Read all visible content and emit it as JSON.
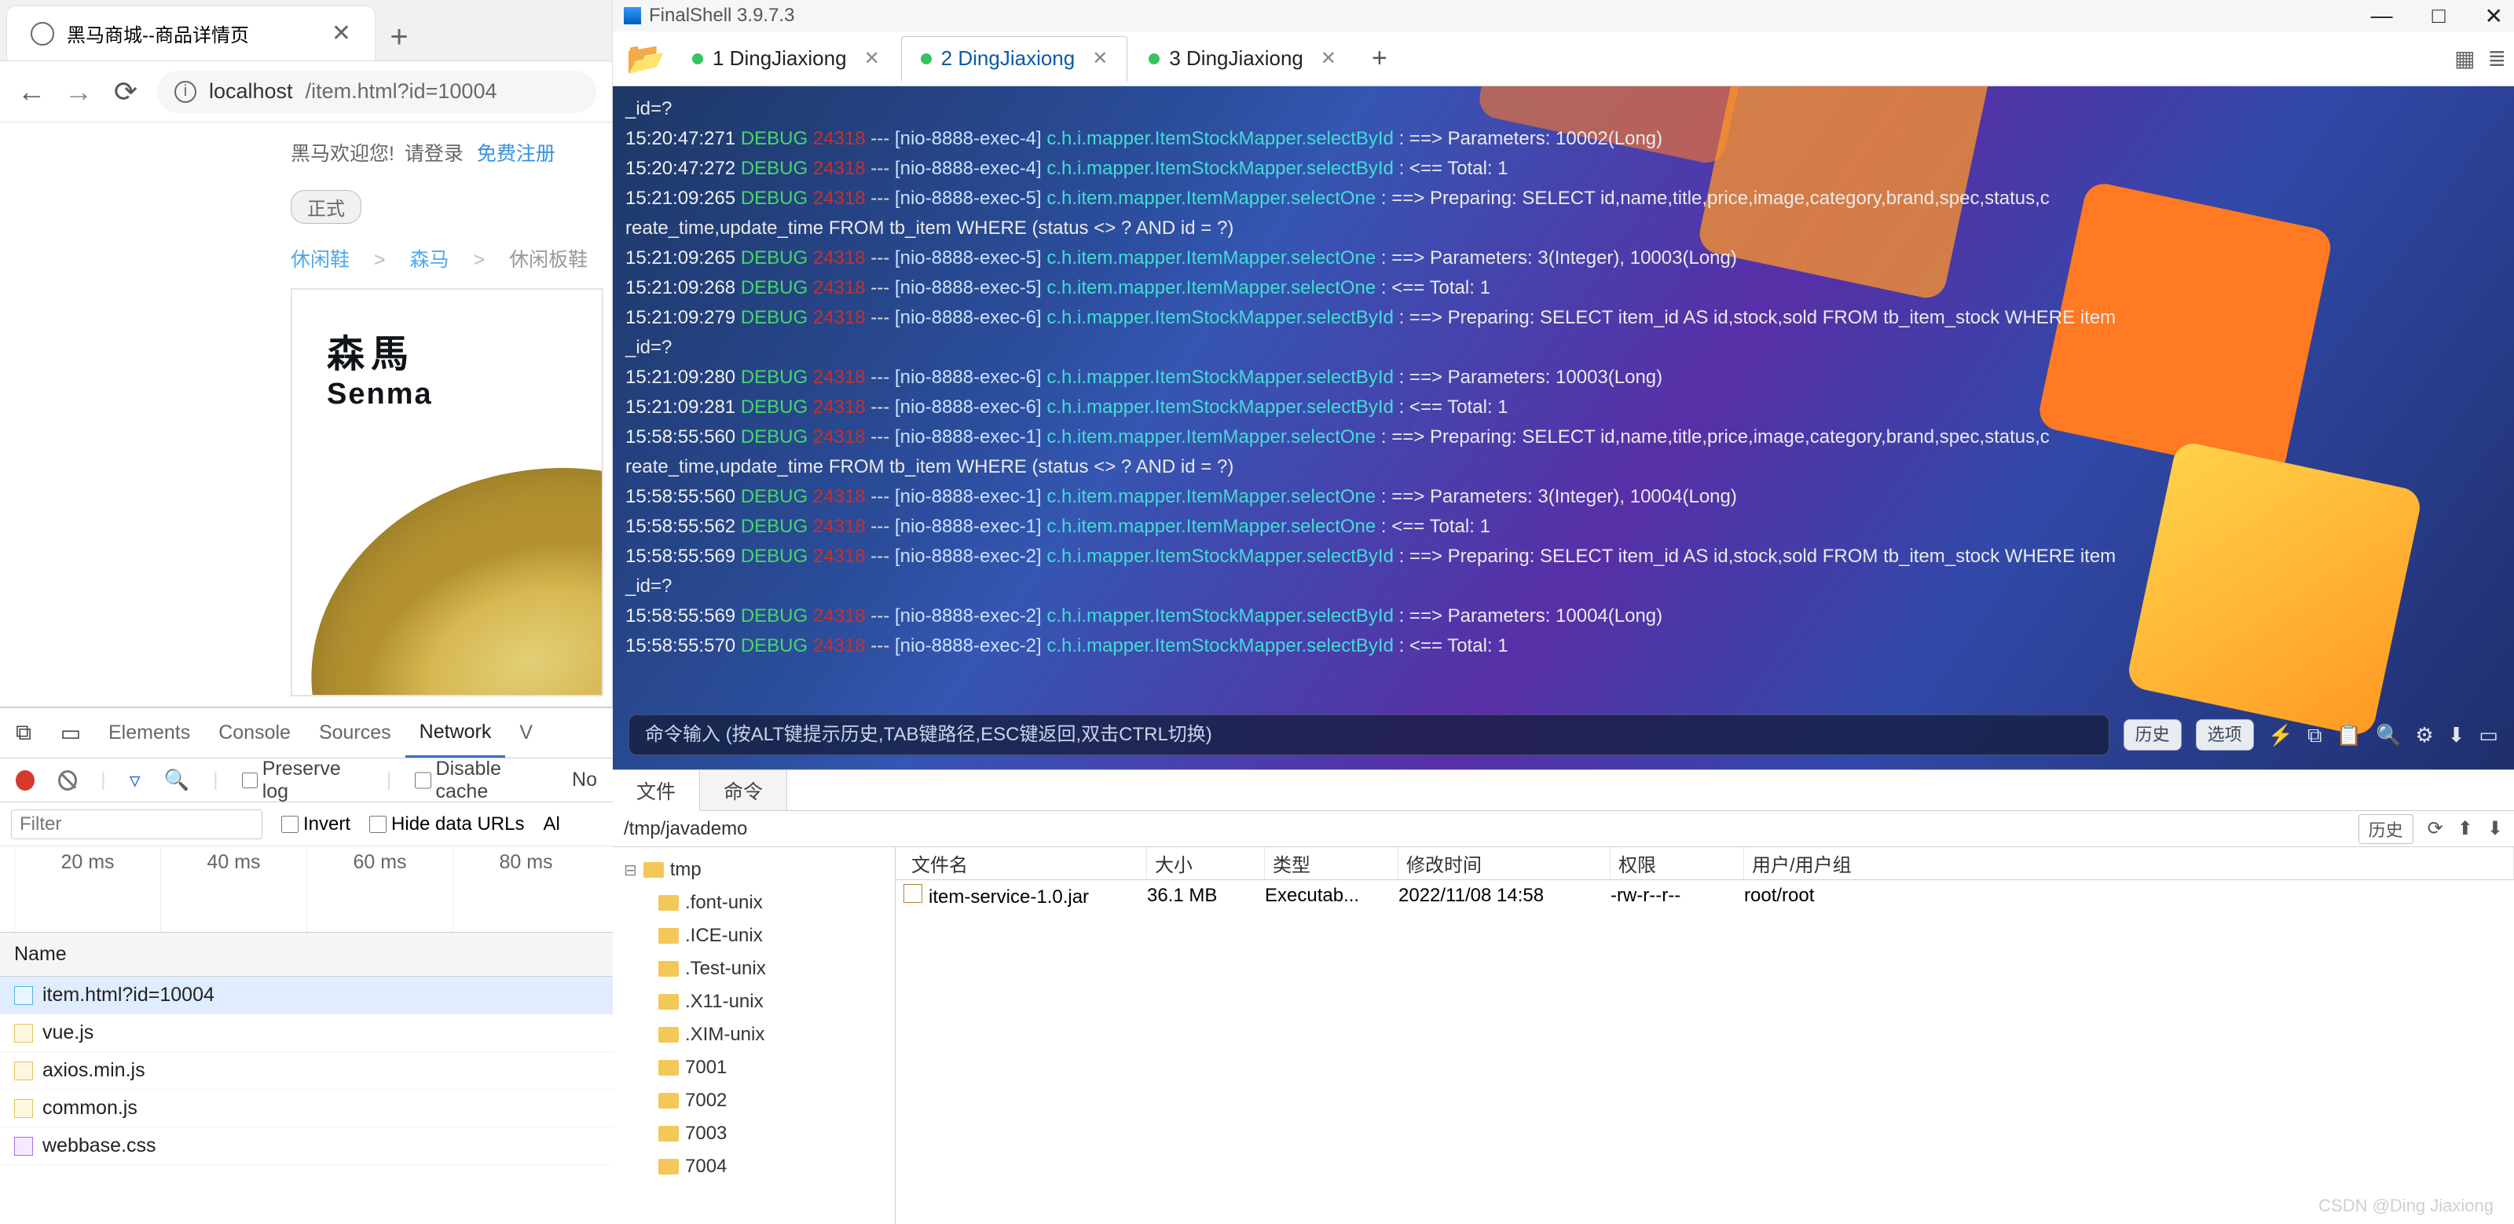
{
  "chrome": {
    "tab_title": "黑马商城--商品详情页",
    "close": "✕",
    "new_tab": "+",
    "nav": {
      "back": "←",
      "forward": "→",
      "reload": "⟳"
    },
    "url_info": "ⓘ",
    "url_host": "localhost",
    "url_rest": "/item.html?id=10004"
  },
  "page": {
    "welcome_a": "黑马欢迎您!",
    "login": "请登录",
    "register": "免费注册",
    "official": "正式",
    "breadcrumb": {
      "cat1": "休闲鞋",
      "sep": ">",
      "brand": "森马",
      "cat2": "休闲板鞋"
    },
    "brand_cn": "森馬",
    "brand_en": "Senma"
  },
  "devtools": {
    "tabs": [
      "Elements",
      "Console",
      "Sources",
      "Network"
    ],
    "active_tab": "Network",
    "overflow": "V",
    "preserve_log": "Preserve log",
    "disable_cache": "Disable cache",
    "no_label": "No",
    "filter_placeholder": "Filter",
    "invert": "Invert",
    "hide_data_urls": "Hide data URLs",
    "all": "Al",
    "timing": [
      "20 ms",
      "40 ms",
      "60 ms",
      "80 ms"
    ],
    "name_header": "Name",
    "files": [
      {
        "name": "item.html?id=10004",
        "kind": "html"
      },
      {
        "name": "vue.js",
        "kind": "js"
      },
      {
        "name": "axios.min.js",
        "kind": "js"
      },
      {
        "name": "common.js",
        "kind": "js"
      },
      {
        "name": "webbase.css",
        "kind": "css"
      }
    ]
  },
  "finalshell": {
    "title": "FinalShell 3.9.7.3",
    "win": {
      "min": "—",
      "max": "□",
      "close": "✕"
    },
    "tabs": [
      {
        "label": "1  DingJiaxiong"
      },
      {
        "label": "2  DingJiaxiong"
      },
      {
        "label": "3  DingJiaxiong"
      }
    ],
    "active_tab": 1,
    "plus": "+",
    "log_prompt": "_id=?",
    "log_lines": [
      {
        "t": "15:20:47:271",
        "th": "[nio-8888-exec-4]",
        "lg": "c.h.i.mapper.ItemStockMapper.selectById",
        "m": ": ==>  Parameters: 10002(Long)"
      },
      {
        "t": "15:20:47:272",
        "th": "[nio-8888-exec-4]",
        "lg": "c.h.i.mapper.ItemStockMapper.selectById",
        "m": ": <==      Total: 1"
      },
      {
        "t": "15:21:09:265",
        "th": "[nio-8888-exec-5]",
        "lg": "c.h.item.mapper.ItemMapper.selectOne",
        "m": ": ==>   Preparing: SELECT id,name,title,price,image,category,brand,spec,status,c"
      },
      {
        "wrap": "reate_time,update_time FROM tb_item WHERE (status <> ? AND id = ?)"
      },
      {
        "t": "15:21:09:265",
        "th": "[nio-8888-exec-5]",
        "lg": "c.h.item.mapper.ItemMapper.selectOne",
        "m": ": ==>  Parameters: 3(Integer), 10003(Long)"
      },
      {
        "t": "15:21:09:268",
        "th": "[nio-8888-exec-5]",
        "lg": "c.h.item.mapper.ItemMapper.selectOne",
        "m": ": <==      Total: 1"
      },
      {
        "t": "15:21:09:279",
        "th": "[nio-8888-exec-6]",
        "lg": "c.h.i.mapper.ItemStockMapper.selectById",
        "m": ": ==>   Preparing: SELECT item_id AS id,stock,sold FROM tb_item_stock WHERE item"
      },
      {
        "wrap": "_id=?"
      },
      {
        "t": "15:21:09:280",
        "th": "[nio-8888-exec-6]",
        "lg": "c.h.i.mapper.ItemStockMapper.selectById",
        "m": ": ==>  Parameters: 10003(Long)"
      },
      {
        "t": "15:21:09:281",
        "th": "[nio-8888-exec-6]",
        "lg": "c.h.i.mapper.ItemStockMapper.selectById",
        "m": ": <==      Total: 1"
      },
      {
        "t": "15:58:55:560",
        "th": "[nio-8888-exec-1]",
        "lg": "c.h.item.mapper.ItemMapper.selectOne",
        "m": ": ==>   Preparing: SELECT id,name,title,price,image,category,brand,spec,status,c"
      },
      {
        "wrap": "reate_time,update_time FROM tb_item WHERE (status <> ? AND id = ?)"
      },
      {
        "t": "15:58:55:560",
        "th": "[nio-8888-exec-1]",
        "lg": "c.h.item.mapper.ItemMapper.selectOne",
        "m": ": ==>  Parameters: 3(Integer), 10004(Long)"
      },
      {
        "t": "15:58:55:562",
        "th": "[nio-8888-exec-1]",
        "lg": "c.h.item.mapper.ItemMapper.selectOne",
        "m": ": <==      Total: 1"
      },
      {
        "t": "15:58:55:569",
        "th": "[nio-8888-exec-2]",
        "lg": "c.h.i.mapper.ItemStockMapper.selectById",
        "m": ": ==>   Preparing: SELECT item_id AS id,stock,sold FROM tb_item_stock WHERE item"
      },
      {
        "wrap": "_id=?"
      },
      {
        "t": "15:58:55:569",
        "th": "[nio-8888-exec-2]",
        "lg": "c.h.i.mapper.ItemStockMapper.selectById",
        "m": ": ==>  Parameters: 10004(Long)"
      },
      {
        "t": "15:58:55:570",
        "th": "[nio-8888-exec-2]",
        "lg": "c.h.i.mapper.ItemStockMapper.selectById",
        "m": ": <==      Total: 1"
      }
    ],
    "level": "DEBUG",
    "pid": "24318",
    "dash": "---",
    "cmd_placeholder": "命令输入 (按ALT键提示历史,TAB键路径,ESC键返回,双击CTRL切换)",
    "cmd_hist": "历史",
    "cmd_opt": "选项",
    "bottom_tabs": {
      "file": "文件",
      "cmd": "命令"
    },
    "path": "/tmp/javademo",
    "path_hist": "历史",
    "tree": [
      "tmp",
      ".font-unix",
      ".ICE-unix",
      ".Test-unix",
      ".X11-unix",
      ".XIM-unix",
      "7001",
      "7002",
      "7003",
      "7004"
    ],
    "columns": {
      "name": "文件名",
      "size": "大小",
      "type": "类型",
      "mtime": "修改时间",
      "perm": "权限",
      "owner": "用户/用户组"
    },
    "row": {
      "name": "item-service-1.0.jar",
      "size": "36.1 MB",
      "type": "Executab...",
      "mtime": "2022/11/08 14:58",
      "perm": "-rw-r--r--",
      "owner": "root/root"
    }
  },
  "watermark": "CSDN @Ding Jiaxiong"
}
